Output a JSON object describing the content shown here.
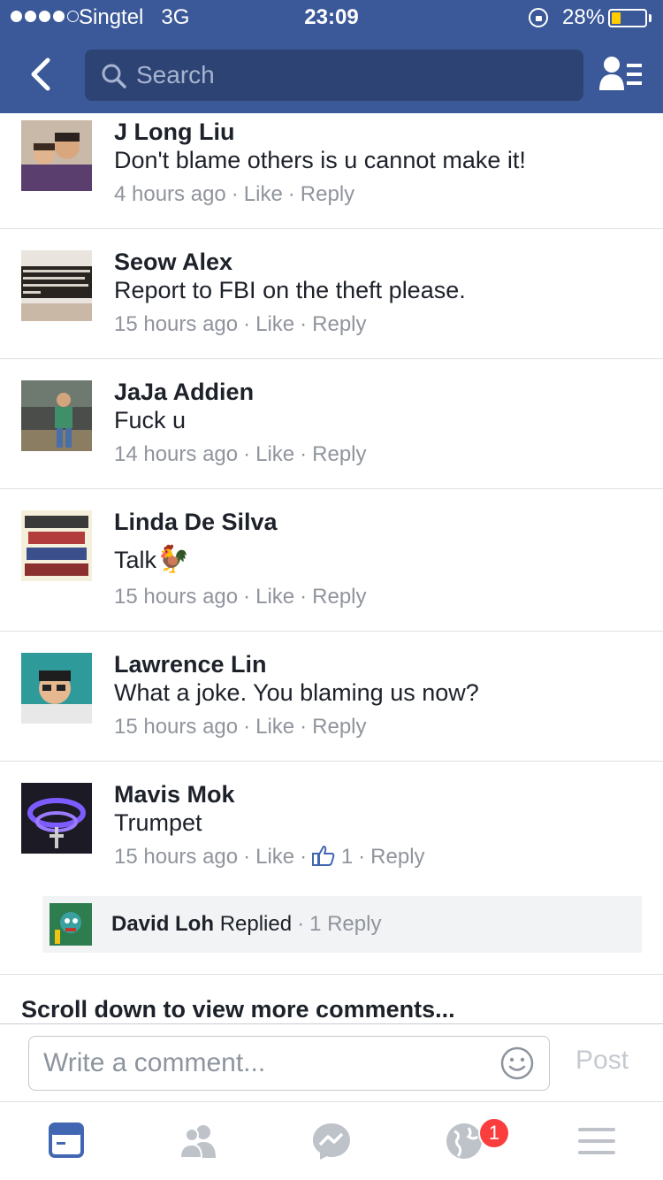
{
  "status_bar": {
    "carrier": "Singtel",
    "network": "3G",
    "time": "23:09",
    "battery": "28%"
  },
  "header": {
    "search_placeholder": "Search"
  },
  "comments": [
    {
      "name": "J Long Liu",
      "text": "Don't blame others is u cannot make it!",
      "time": "4 hours ago",
      "like": "Like",
      "reply": "Reply"
    },
    {
      "name": "Seow Alex",
      "text": "Report to FBI on the theft please.",
      "time": "15 hours ago",
      "like": "Like",
      "reply": "Reply"
    },
    {
      "name": "JaJa Addien",
      "text": "Fuck u",
      "time": "14 hours ago",
      "like": "Like",
      "reply": "Reply"
    },
    {
      "name": "Linda De Silva",
      "text": "Talk",
      "emoji": "🐓",
      "time": "15 hours ago",
      "like": "Like",
      "reply": "Reply"
    },
    {
      "name": "Lawrence Lin",
      "text": "What a joke. You blaming us now?",
      "time": "15 hours ago",
      "like": "Like",
      "reply": "Reply"
    },
    {
      "name": "Mavis Mok",
      "text": "Trumpet",
      "time": "15 hours ago",
      "like": "Like",
      "like_count": "1",
      "reply": "Reply"
    }
  ],
  "reply_summary": {
    "name": "David Loh",
    "action": "Replied",
    "count": "1 Reply"
  },
  "scroll_more": "Scroll down to view more comments...",
  "compose": {
    "placeholder": "Write a comment...",
    "post_label": "Post"
  },
  "tabs": [
    "news-feed-icon",
    "friends-icon",
    "messenger-icon",
    "notifications-globe-icon",
    "menu-icon"
  ],
  "notifications_badge": "1",
  "colors": {
    "header_blue": "#3b5998",
    "search_bg": "#2d4373",
    "meta_gray": "#90949c",
    "active_tab": "#4267b2",
    "inactive_tab": "#bec2c9",
    "badge_red": "#fa3e3e"
  }
}
